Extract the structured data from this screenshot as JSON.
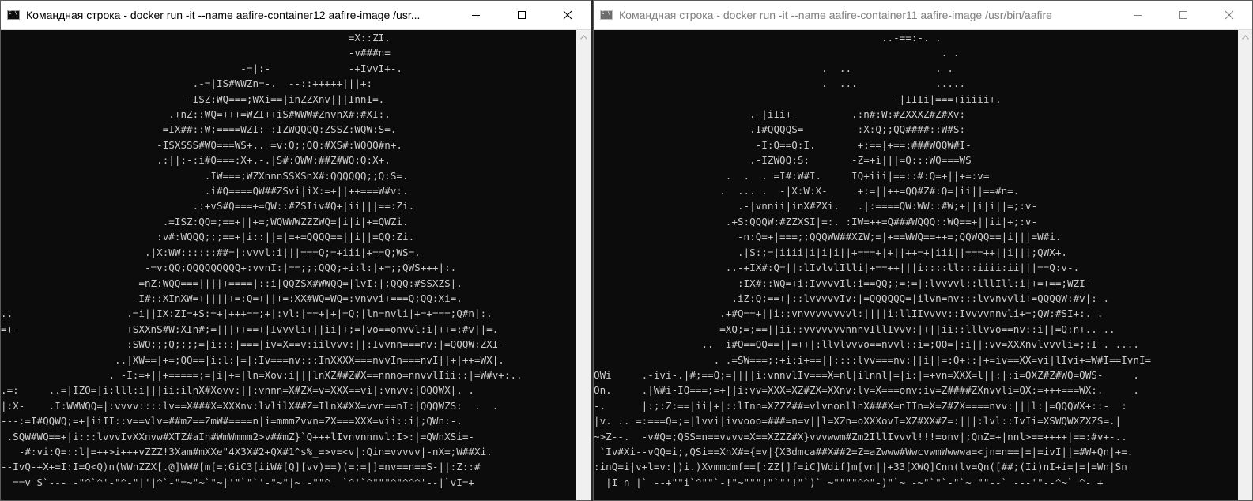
{
  "windows": [
    {
      "title": "Командная строка - docker  run -it --name aafire-container12 aafire-image /usr...",
      "active": true,
      "icon": "cmd-icon",
      "controls": [
        "minimize-icon",
        "maximize-icon",
        "close-icon"
      ],
      "console_lines": [
        "                                                          =X::ZI.",
        "                                                          -v###n=",
        "                                        -=|:-             -+IvvI+-.",
        "                                .-=|IS#WWZn=-.  --::+++++|||+:",
        "                               -ISZ:WQ===;WXi==|inZZXnv|||InnI=.",
        "                            .+nZ::WQ=+++=WZI++iS#WWW#ZnvnX#:#XI:.",
        "                           =IX##::W;====WZI:-:IZWQQQQ:ZSSZ:WQW:S=.",
        "                          -ISXSSS#WQ===WS+.. =v:Q;;QQ:#XS#:WQQQ#n+.",
        "                          .:||:-:i#Q===:X+.-.|S#:QWW:##Z#WQ;Q:X+.",
        "                                  .IW===;WZXnnnSSXSnX#:QQQQQQ;;Q:S=.",
        "                                  .i#Q====QW##ZSvi|iX:=+||++===W#v:.",
        "                                .:+vS#Q===+=QW::#ZSIiv#Q+|ii|||==:Zi.",
        "                           .=ISZ:QQ=;==+||+=;WQWWWZZZWQ=|i|i|+=QWZi.",
        "                          :v#:WQQQ;;;==+|i::||=|=+=QQQQ==||i||=QQ:Zi.",
        "                        .|X:WW::::::##=|:vvvl:i|||===Q;=+iii|+==Q;WS=.",
        "                        -=v:QQ;QQQQQQQQQ+:vvnI:|==;;;QQQ;+i:l:|+=;;QWS+++|:.",
        "                       =nZ:WQQ===||||+====|::i|QQZSX#WWQQ=|lvI:|;QQQ:#SSXZS|.",
        "                      -I#::XInXW=+||||+=:Q=+||+=:XX#WQ=WQ=:vnvvi+===Q;QQ:Xi=.",
        "..                   .=i||IX:ZI=+S:=+|+++==;+|:vl:|==+|+|=Q;|ln=nvli|+=+===;Q#n|:.",
        "=+-                  +SXXnS#W:XIn#;=|||++==+|Ivvvli+||ii|+;=|vo==onvvl:i|++=:#v||=.",
        "                     :SWQ;;;Q;;;;=|i:::|===|iv=X==v:iilvvv:||:Ivvnn===nv:|=QQQW:ZXI-",
        "                   ..|XW==|+=;QQ==|i:l:|=|:Iv===nv:::InXXXX===nvvIn===nvI||+|++=WX|.",
        "                  . -I:=+||+=====;=|i|+=|ln=Xov:i|||lnXZ##Z#X==nnno=nnvvlIii::|=W#v+:..",
        ".=:     ..=|IZQ=|i:lll:i|||ii:ilnX#Xovv:||:vnnn=X#ZX=v=XXX==vi|:vnvv:|QQQWX|. .",
        "|:X-    .I:WWWQQ=|:vvvv::::lv==X###X=XXXnv:lvlilX##Z=IlnX#XX=vvn==nI:|QQQWZS:  .  .",
        "---:=I#QQWQ;=+|iiII::v==vlv=##mZ==ZmW#====n|i=mmmZvvn=ZX===XXX=vii::i|;QWn:-.",
        " .SQW#WQ==+|i:::lvvvIvXXnvw#XTZ#aIn#WmWmmm2>v##mZ}`Q+++lIvnvnnnvl:I>:|=QWnXSi=-",
        "   -#:vi:Q=::l|=++>i+++vZZZ!3Xam#mXXe\"4X3X#2+QX#1^s%_=>v=<v|:Qin=vvvvv|-nX=;W##Xi.",
        "--IvQ-+X+=I:I=Q<Q)n(WWnZZX[.@]WW#[m[=;GiC3[iiW#[Q][vv)==)(=;=|]=nv==n==S-||:Z::#",
        "  ==v S`--- -\"^`^'-\"^-\"|'|^`-\"=~\"~`\"~|'\"`\"`'-\"~\"|~ -\"\"^  `^'`^\"\"\"^\"^^^'--|`vI=+"
      ]
    },
    {
      "title": "Командная строка - docker  run -it --name aafire-container11 aafire-image /usr/bin/aafire",
      "active": false,
      "icon": "cmd-icon",
      "controls": [
        "minimize-icon",
        "maximize-icon",
        "close-icon"
      ],
      "console_lines": [
        "                                                ..-==:-. .",
        "                                                          . .",
        "                                      .  ..              . .",
        "                                      .  ...             .....",
        "                                                  -|IIIi|===+iiiii+.",
        "                          .-|iIi+-         .:n#:W:#ZXXXZ#Z#Xv:",
        "                          .I#QQQQS=         :X:Q;;QQ####::W#S:",
        "                           -I:Q==Q:I.       +:==|+==:###WQQW#I-",
        "                          .-IZWQQ:S:       -Z=+i|||=Q:::WQ===WS",
        "                      .  .  . =I#:W#I.     IQ+iii|==::#:Q=+||+=:v=",
        "                     .  ... .  -|X:W:X-     +:=||++=QQ#Z#:Q=|ii||==#n=.",
        "                        .-|vnnii|inX#ZXi.   .|:====QW:WW::#W;+||i|i||=;:v-",
        "                      .+S:QQQW:#ZZXSI|=:. :IW=++=Q###WQQQ::WQ==+||ii|+;:v-",
        "                        -n:Q=+|===;;QQQWW##XZW;=|+==WWQ==++=;QQWQQ==|i|||=W#i.",
        "                        .|S:;=|iiii|i|i|i||+===+|+||++=+|iii||===++||i|||;QWX+.",
        "                      ..-+IX#:Q=||:lIvlvlIlli|+==++|||i::::ll:::iiii:ii|||==Q:v-.",
        "                        :IX#::WQ=+i:IvvvvIl:i==QQ;;=;=|:lvvvvl::lllIll:i|+=+==;WZI-",
        "                       .iZ:Q;==+|::lvvvvvIv:|=QQQQQQ=|ilvn=nv:::lvvnvvli+=QQQQW:#v|:-.",
        "                     .+#Q==+||i::vnvvvvvvvvl:||||i:llIIvvvv::Ivvvvnnvli+=;QW:#SI+:. .",
        "                     =XQ;=;==||ii::vvvvvvvnnnvIllIvvv:|+||ii::lllvvo==nv::i||=Q:n+.. ..",
        "                  .. -i#Q==QQ==||=++|:llvlvvvo==nvvl::i=;QQ=|:i||:vv=XXXnvlvvvli=;:I-. ....",
        "                    . .=SW===;;+i:i+==||::::lvv===nv:||i||=:Q+::|+=iv==XX=vi|lIvi+=W#I==IvnI=",
        "QWi     .-ivi-.|#;==Q;=||||i:vnnvlIv===X=nl|ilnnl|=|i:|=+vn=XXX=l||:|:i=QXZ#Z#WQ=QWS-     .",
        "Qn.     .|W#i-IQ===;=+||i:vv=XXX=XZ#ZX=XXnv:lv=X===onv:iv=Z####ZXnvvli=QX:=+++===WX:.     .",
        "-.      |:;:Z:==|ii|+|::lInn=XZZZ##=vlvnonllnX###X=nIIn=X=Z#ZX====nvv:|||l:|=QQQWX+::-  :",
        "|v. .. =:===Q=;=|lvvi|ivvooo=###=n=v||l=XZn=oXXXovI=XZ#XX#Z=:|||:lvl::IvIi=XSWQWXZXZS=.|",
        "~>Z--.  -v#Q=;QSS=n==vvvv=X==XZZZ#X}vvvwwm#Zm2IllIvvvl!!!=onv|;QnZ=+|nnl>==++++|==:#v+-..",
        " `Iv#Xi--vQQ=i;,QSi==XnX#={=v|{X3dmca##X##2=Z=aZwww#WwcvwmWwwwa=<jn=n==|=|=ivI||=#W+Qn|+=.",
        ":inQ=i|v+l=v:|)i.)Xvmmdmf==[:ZZ[]f=iC]Wdif]m[vn||+33[XWQ]Cnn(lv=Qn([##;(Ii)nI+i=|=|=Wn|Sn",
        "  |I n |` --+\"\"i`^\"\"`-!\"~\"\"\"!\"`\"'!\"`)` ~\"\"\"\"^^\"-)\"`~ -~\"`\"`-\"`~ \"\"--` ---'\"--^~` ^- +"
      ]
    }
  ]
}
